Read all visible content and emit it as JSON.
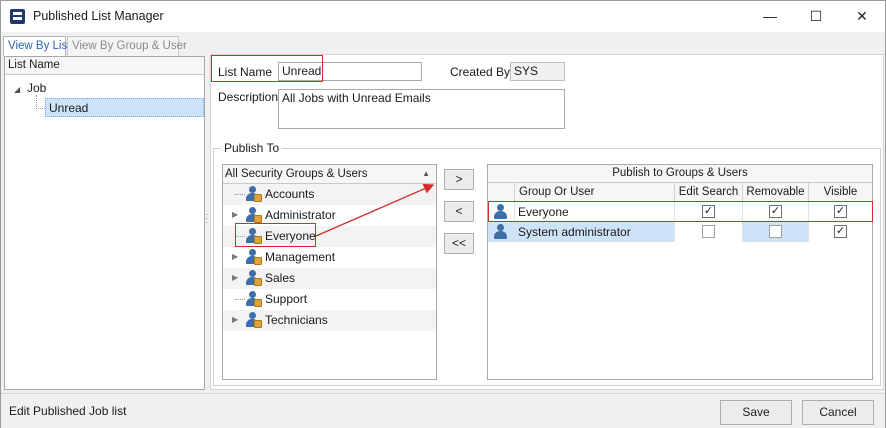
{
  "window": {
    "title": "Published List Manager",
    "minimize": "—",
    "maximize": "☐",
    "close": "✕"
  },
  "tabs": [
    {
      "label": "View By List",
      "active": true
    },
    {
      "label": "View By Group & User",
      "active": false
    }
  ],
  "tree": {
    "header": "List Name",
    "root": "Job",
    "child": "Unread"
  },
  "form": {
    "list_name_label": "List Name",
    "list_name_value": "Unread",
    "created_by_label": "Created By",
    "created_by_value": "SYS",
    "description_label": "Description",
    "description_value": "All Jobs with Unread Emails"
  },
  "publish_to": {
    "legend": "Publish To",
    "available_header": "All Security Groups & Users",
    "groups": [
      {
        "label": "Accounts",
        "expandable": false
      },
      {
        "label": "Administrator",
        "expandable": true
      },
      {
        "label": "Everyone",
        "expandable": false
      },
      {
        "label": "Management",
        "expandable": true
      },
      {
        "label": "Sales",
        "expandable": true
      },
      {
        "label": "Support",
        "expandable": false
      },
      {
        "label": "Technicians",
        "expandable": true
      }
    ],
    "buttons": {
      "add": ">",
      "remove": "<",
      "remove_all": "<<"
    },
    "published": {
      "title": "Publish to Groups & Users",
      "columns": [
        "Group Or User",
        "Edit Search",
        "Removable",
        "Visible"
      ],
      "rows": [
        {
          "name": "Everyone",
          "edit_search": true,
          "removable": true,
          "visible": true,
          "selected": false
        },
        {
          "name": "System administrator",
          "edit_search": false,
          "removable": false,
          "visible": true,
          "selected": true
        }
      ]
    }
  },
  "status": {
    "text": "Edit Published Job list"
  },
  "footer": {
    "save": "Save",
    "cancel": "Cancel"
  },
  "colors": {
    "selection": "#cde3f7",
    "annotation": "#d22d2d",
    "active_tab": "#2e64b0"
  }
}
